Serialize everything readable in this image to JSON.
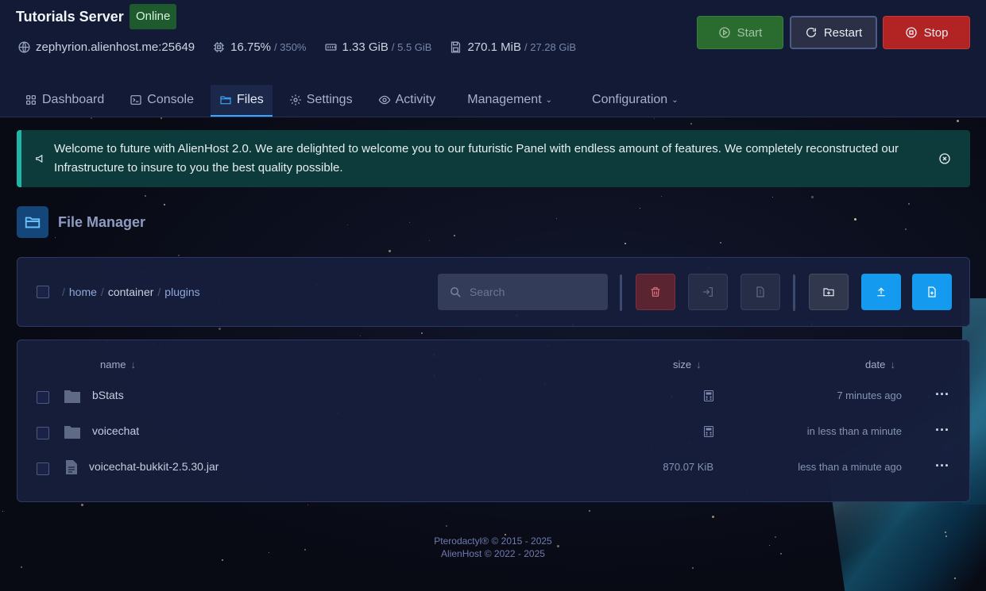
{
  "server": {
    "title": "Tutorials Server",
    "status": "Online",
    "address": "zephyrion.alienhost.me:25649",
    "cpu": "16.75%",
    "cpu_limit": "/ 350%",
    "memory": "1.33 GiB",
    "memory_limit": "/ 5.5 GiB",
    "disk": "270.1 MiB",
    "disk_limit": "/ 27.28 GiB"
  },
  "controls": {
    "start": "Start",
    "restart": "Restart",
    "stop": "Stop"
  },
  "tabs": [
    {
      "label": "Dashboard",
      "icon": "grid-icon"
    },
    {
      "label": "Console",
      "icon": "terminal-icon"
    },
    {
      "label": "Files",
      "icon": "folder-icon",
      "active": true
    },
    {
      "label": "Settings",
      "icon": "gear-icon"
    },
    {
      "label": "Activity",
      "icon": "eye-icon"
    },
    {
      "label": "Management",
      "icon": "chevron-down-icon"
    },
    {
      "label": "Configuration",
      "icon": "chevron-down-icon"
    }
  ],
  "alert": {
    "text": "Welcome to future with AlienHost 2.0. We are delighted to welcome you to our futuristic Panel with endless amount of features. We completely reconstructed our Infrastructure to insure to you the best quality possible."
  },
  "file_manager": {
    "title": "File Manager",
    "breadcrumb": [
      "home",
      "container",
      "plugins"
    ],
    "search_placeholder": "Search",
    "columns": {
      "name": "name",
      "size": "size",
      "date": "date"
    },
    "files": [
      {
        "name": "bStats",
        "type": "folder",
        "size": "",
        "date": "7 minutes ago"
      },
      {
        "name": "voicechat",
        "type": "folder",
        "size": "",
        "date": "in less than a minute"
      },
      {
        "name": "voicechat-bukkit-2.5.30.jar",
        "type": "file",
        "size": "870.07 KiB",
        "date": "less than a minute ago"
      }
    ]
  },
  "footer": {
    "line1": "Pterodactyl® © 2015 - 2025",
    "line2": "AlienHost © 2022 - 2025"
  },
  "colors": {
    "accent": "#38a6ff",
    "online": "#1f5a2e",
    "stop": "#b22424",
    "start": "#2a6b2f",
    "alert": "#0d3b3c"
  }
}
